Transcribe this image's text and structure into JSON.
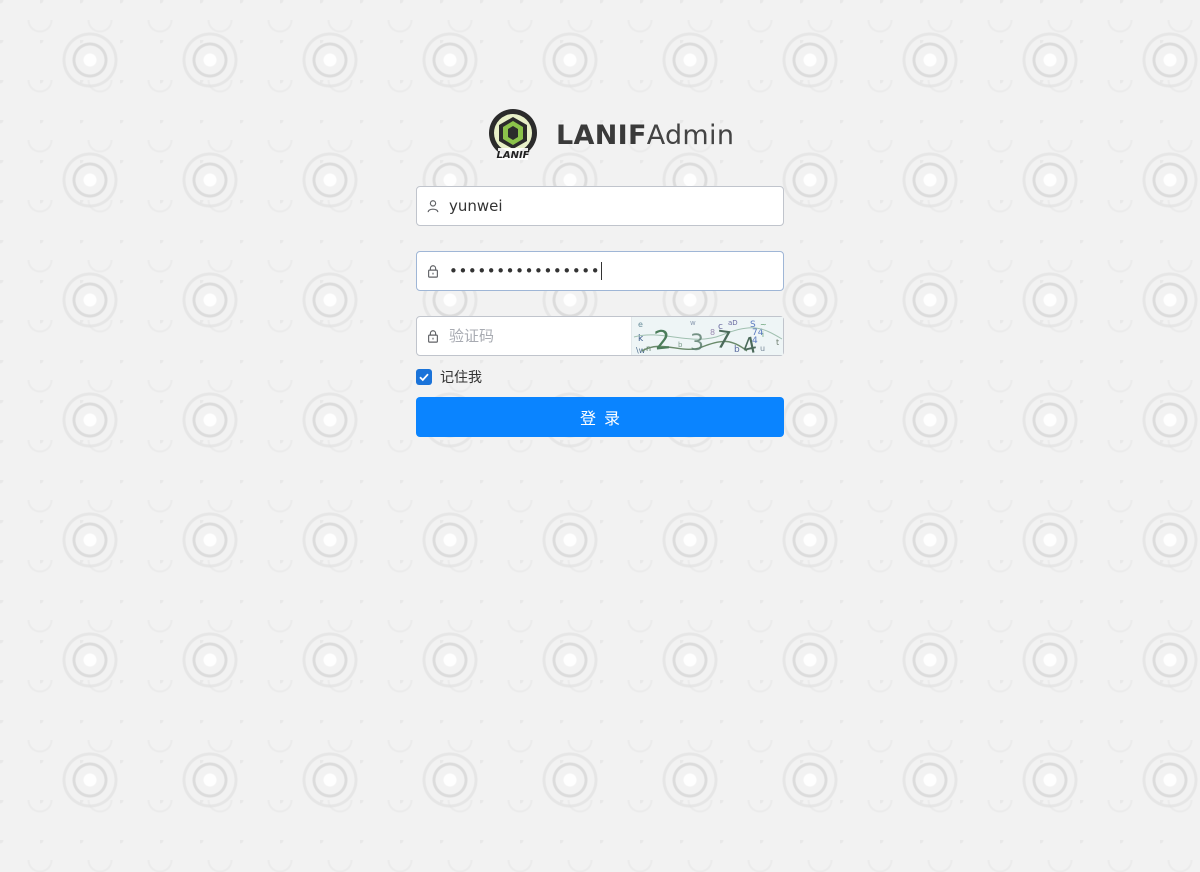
{
  "brand": {
    "logo_text": "LANIF",
    "name_bold": "LANIF",
    "name_light": "Admin"
  },
  "form": {
    "username": {
      "value": "yunwei",
      "icon": "user-icon"
    },
    "password": {
      "masked_value": "••••••••••••••••",
      "icon": "lock-icon"
    },
    "captcha": {
      "placeholder": "验证码",
      "icon": "lock-icon",
      "image_text": "2374"
    },
    "remember": {
      "label": "记住我",
      "checked": true
    },
    "submit_label": "登录"
  },
  "colors": {
    "primary": "#0a84ff",
    "checkbox": "#1a73d9",
    "logo_green": "#8bc34a"
  }
}
